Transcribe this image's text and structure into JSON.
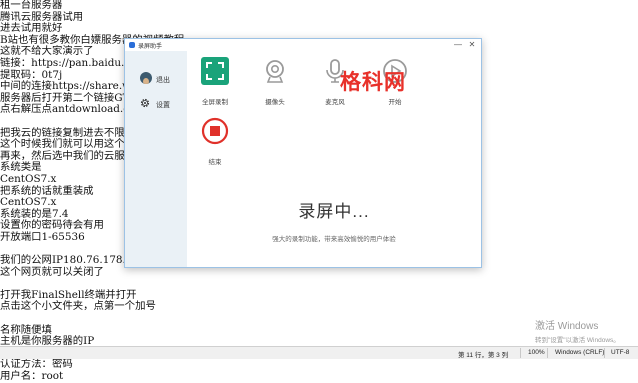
{
  "background_lines": [
    "租一台服务器",
    "腾讯云服务器试用",
    "进去试用就好",
    "B站也有很多教你白嫖服务器的视频教程",
    "这就不给大家演示了",
    "链接：https://pan.baidu.com/...",
    "提取码：0t7j",
    "中间的连接https://share.weiyun.com/...",
    "服务器后打开第二个链接GTMD解压",
    "点右解压点antdownload.exe",
    "",
    "把我云的链接复制进去不限速下载",
    "这个时候我们就可以用这个时间来",
    "再来，然后选中我们的云服务器",
    "系统类是",
    "CentOS7.x",
    "把系统的话就重装成",
    "CentOS7.x",
    "系统装的是7.4",
    "设置你的密码待会有用",
    "开放端口1-65536",
    "",
    "我们的公网IP180.76.178.178",
    "这个网页就可以关闭了",
    "",
    "打开我FinalShell终端并打开",
    "点击这个小文件夹，点第一个加号",
    "",
    "名称随便填",
    "主机是你服务器的IP",
    "端口默认22",
    "认证方法：密码",
    "用户名：root"
  ],
  "statusbar": {
    "position": "第 11 行，第 3 列",
    "zoom": "100%",
    "line_ending": "Windows (CRLF)",
    "encoding": "UTF-8"
  },
  "watermark": {
    "title": "激活 Windows",
    "subtitle": "转到\"设置\"以激活 Windows。"
  },
  "recorder": {
    "title": "录屏助手",
    "minimize": "—",
    "close": "✕",
    "sidebar": {
      "logout_label": "退出",
      "settings_label": "设置"
    },
    "tools": {
      "fullscreen_label": "全屏录制",
      "camera_label": "摄像头",
      "mic_label": "麦克风",
      "start_label": "开始",
      "end_label": "结束"
    },
    "status_text": "录屏中...",
    "status_subtext": "强大的录制功能，带来高效愉悦的用户体验"
  },
  "site_logo": {
    "text": "格科网"
  },
  "colors": {
    "accent_green": "#1aa37a",
    "stop_red": "#e0312a",
    "sidebar_bg": "#eaf1f6",
    "logo_red": "#e8312a"
  }
}
